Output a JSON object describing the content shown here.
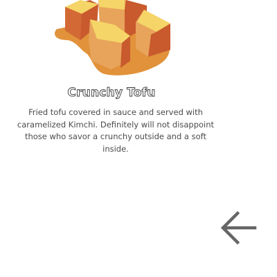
{
  "item": {
    "title": "Crunchy Tofu",
    "description": "Fried tofu covered in sauce and served with caramelized Kimchi. Definitely will not disappoint those who savor a crunchy outside and a soft inside.",
    "image_icon": "tofu-illustration"
  },
  "navigation": {
    "back_icon": "arrow-left-icon"
  },
  "colors": {
    "tofu_top": "#f5d567",
    "tofu_side_light": "#e8a45b",
    "tofu_side_dark": "#c85a2e",
    "sauce": "#e1923a",
    "text": "#4a4a4a",
    "icon": "#666666"
  }
}
